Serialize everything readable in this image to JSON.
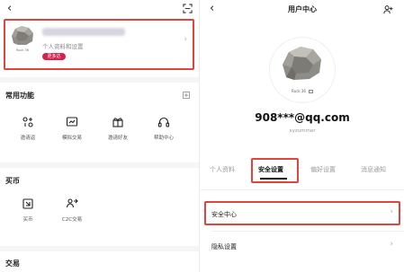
{
  "left": {
    "back_glyph": "‹",
    "scan_icon": "scan-icon",
    "profile": {
      "subtitle": "个人资料和设置",
      "tag": "更多达",
      "chevron": "›",
      "avatar_caption": "Rock 36"
    },
    "sections": [
      {
        "title": "常用功能",
        "items": [
          {
            "label": "邀请返",
            "icon": "invite-icon"
          },
          {
            "label": "模拟交易",
            "icon": "simulated-trading-icon"
          },
          {
            "label": "邀请好友",
            "icon": "gift-icon"
          },
          {
            "label": "帮助中心",
            "icon": "headset-icon"
          }
        ]
      },
      {
        "title": "买币",
        "items": [
          {
            "label": "买币",
            "icon": "buy-coin-icon"
          },
          {
            "label": "C2C交易",
            "icon": "c2c-icon"
          }
        ]
      },
      {
        "title": "交易",
        "items": []
      }
    ]
  },
  "right": {
    "back_glyph": "‹",
    "title": "用户中心",
    "add_user_icon": "user-add-icon",
    "avatar_caption": "Rock 36",
    "email": "908***@qq.com",
    "username": "xyzummer",
    "tabs": [
      {
        "label": "个人资料",
        "active": false
      },
      {
        "label": "安全设置",
        "active": true
      },
      {
        "label": "偏好设置",
        "active": false
      },
      {
        "label": "消息通知",
        "active": false
      }
    ],
    "rows": [
      {
        "label": "安全中心",
        "chevron": "›",
        "highlighted": true
      },
      {
        "label": "隐私设置",
        "chevron": "›",
        "highlighted": false
      }
    ]
  },
  "colors": {
    "highlight_border": "#e0443a",
    "tag_red": "#d6224d"
  }
}
